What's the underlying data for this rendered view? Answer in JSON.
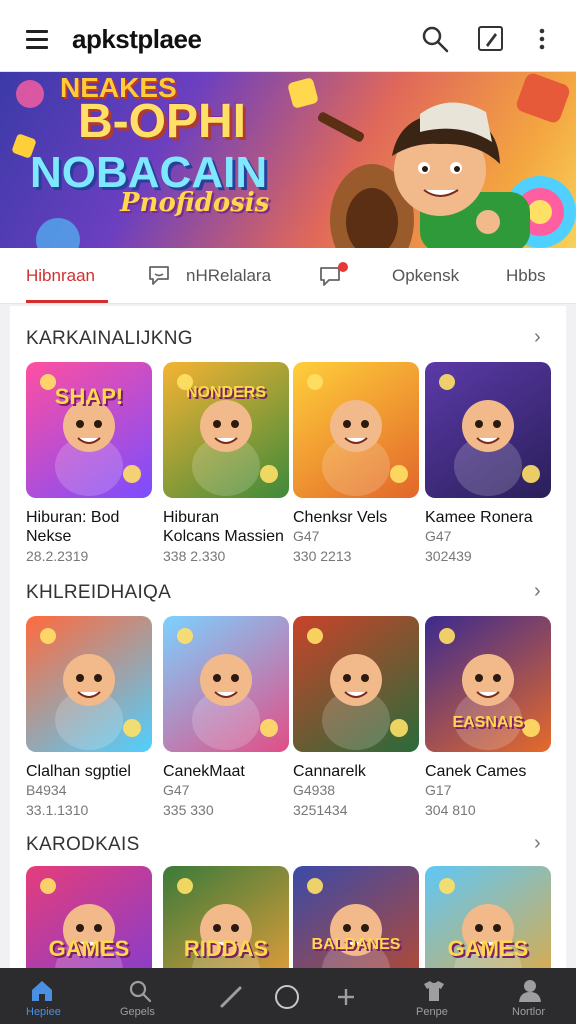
{
  "app": {
    "title": "apkstplaee"
  },
  "banner": {
    "line1": "NEAKES",
    "line2": "B-OPHI",
    "line3": "NOBACAIN",
    "line4": "Pnofidosis"
  },
  "tabs": [
    {
      "label": "Hibnraan"
    },
    {
      "label": "nHRelalara"
    },
    {
      "label": "Opkensk"
    },
    {
      "label": "Hbbs"
    }
  ],
  "sections": [
    {
      "title": "KARKAINALIJKNG",
      "cards": [
        {
          "title": "Hiburan: Bod",
          "title2": "Nekse",
          "sub1": "",
          "sub2": "28.2.2319",
          "art": "SHAP!",
          "colors": [
            "#ff4fa0",
            "#7b4dff"
          ]
        },
        {
          "title": "Hiburan",
          "title2": "Kolcans Massien",
          "sub1": "",
          "sub2": "338 2.330",
          "art": "NONDERS",
          "colors": [
            "#f6b333",
            "#3d8a3a"
          ]
        },
        {
          "title": "Chenksr Vels",
          "title2": "",
          "sub1": "G47",
          "sub2": "330 2213",
          "art": "",
          "colors": [
            "#ffcf3a",
            "#e2662a"
          ]
        },
        {
          "title": "Kamee Ronera",
          "title2": "",
          "sub1": "G47",
          "sub2": "302439",
          "art": "",
          "colors": [
            "#5b3aa8",
            "#2a1f5a"
          ]
        }
      ]
    },
    {
      "title": "KHLREIDHAIQA",
      "cards": [
        {
          "title": "Clalhan sgptiel",
          "title2": "",
          "sub1": "B4934",
          "sub2": "33.1.1310",
          "art": "",
          "colors": [
            "#ff6a3d",
            "#4fd0ff"
          ]
        },
        {
          "title": "CanekMaat",
          "title2": "",
          "sub1": "G47",
          "sub2": "335 330",
          "art": "",
          "colors": [
            "#7cd1ff",
            "#e14e86"
          ]
        },
        {
          "title": "Cannarelk",
          "title2": "",
          "sub1": "G4938",
          "sub2": "3251434",
          "art": "",
          "colors": [
            "#c9432a",
            "#2a6b3a"
          ]
        },
        {
          "title": "Canek Cames",
          "title2": "",
          "sub1": "G17",
          "sub2": "304 810",
          "art": "EASNAIS",
          "colors": [
            "#3b2a8f",
            "#e66b2a"
          ]
        }
      ]
    },
    {
      "title": "KARODKAIS",
      "cards": [
        {
          "title": "",
          "title2": "",
          "sub1": "",
          "sub2": "",
          "art": "GAMES",
          "colors": [
            "#e53d7a",
            "#7c3dd6"
          ]
        },
        {
          "title": "",
          "title2": "",
          "sub1": "",
          "sub2": "",
          "art": "RIDDAS",
          "colors": [
            "#3a7a3a",
            "#f2a13a"
          ]
        },
        {
          "title": "",
          "title2": "",
          "sub1": "",
          "sub2": "",
          "art": "BALDANES",
          "colors": [
            "#3b4aa8",
            "#c04a2a"
          ]
        },
        {
          "title": "",
          "title2": "",
          "sub1": "",
          "sub2": "",
          "art": "GAMES",
          "colors": [
            "#5fc7f7",
            "#e7a83a"
          ]
        }
      ]
    }
  ],
  "bottom_nav": [
    {
      "label": "Hepiee",
      "icon": "home-icon",
      "active": true
    },
    {
      "label": "Gepels",
      "icon": "search-icon",
      "active": false
    },
    {
      "label": "",
      "icon": "pen-icon",
      "active": false
    },
    {
      "label": "",
      "icon": "circle-icon",
      "active": false
    },
    {
      "label": "",
      "icon": "plus-icon",
      "active": false
    },
    {
      "label": "Penpe",
      "icon": "shirt-icon",
      "active": false
    },
    {
      "label": "Nortlor",
      "icon": "profile-icon",
      "active": false
    }
  ],
  "colors": {
    "accent": "#d32f2f",
    "nav_active": "#4a90e2",
    "bottom_bar": "#2c2c2e"
  }
}
